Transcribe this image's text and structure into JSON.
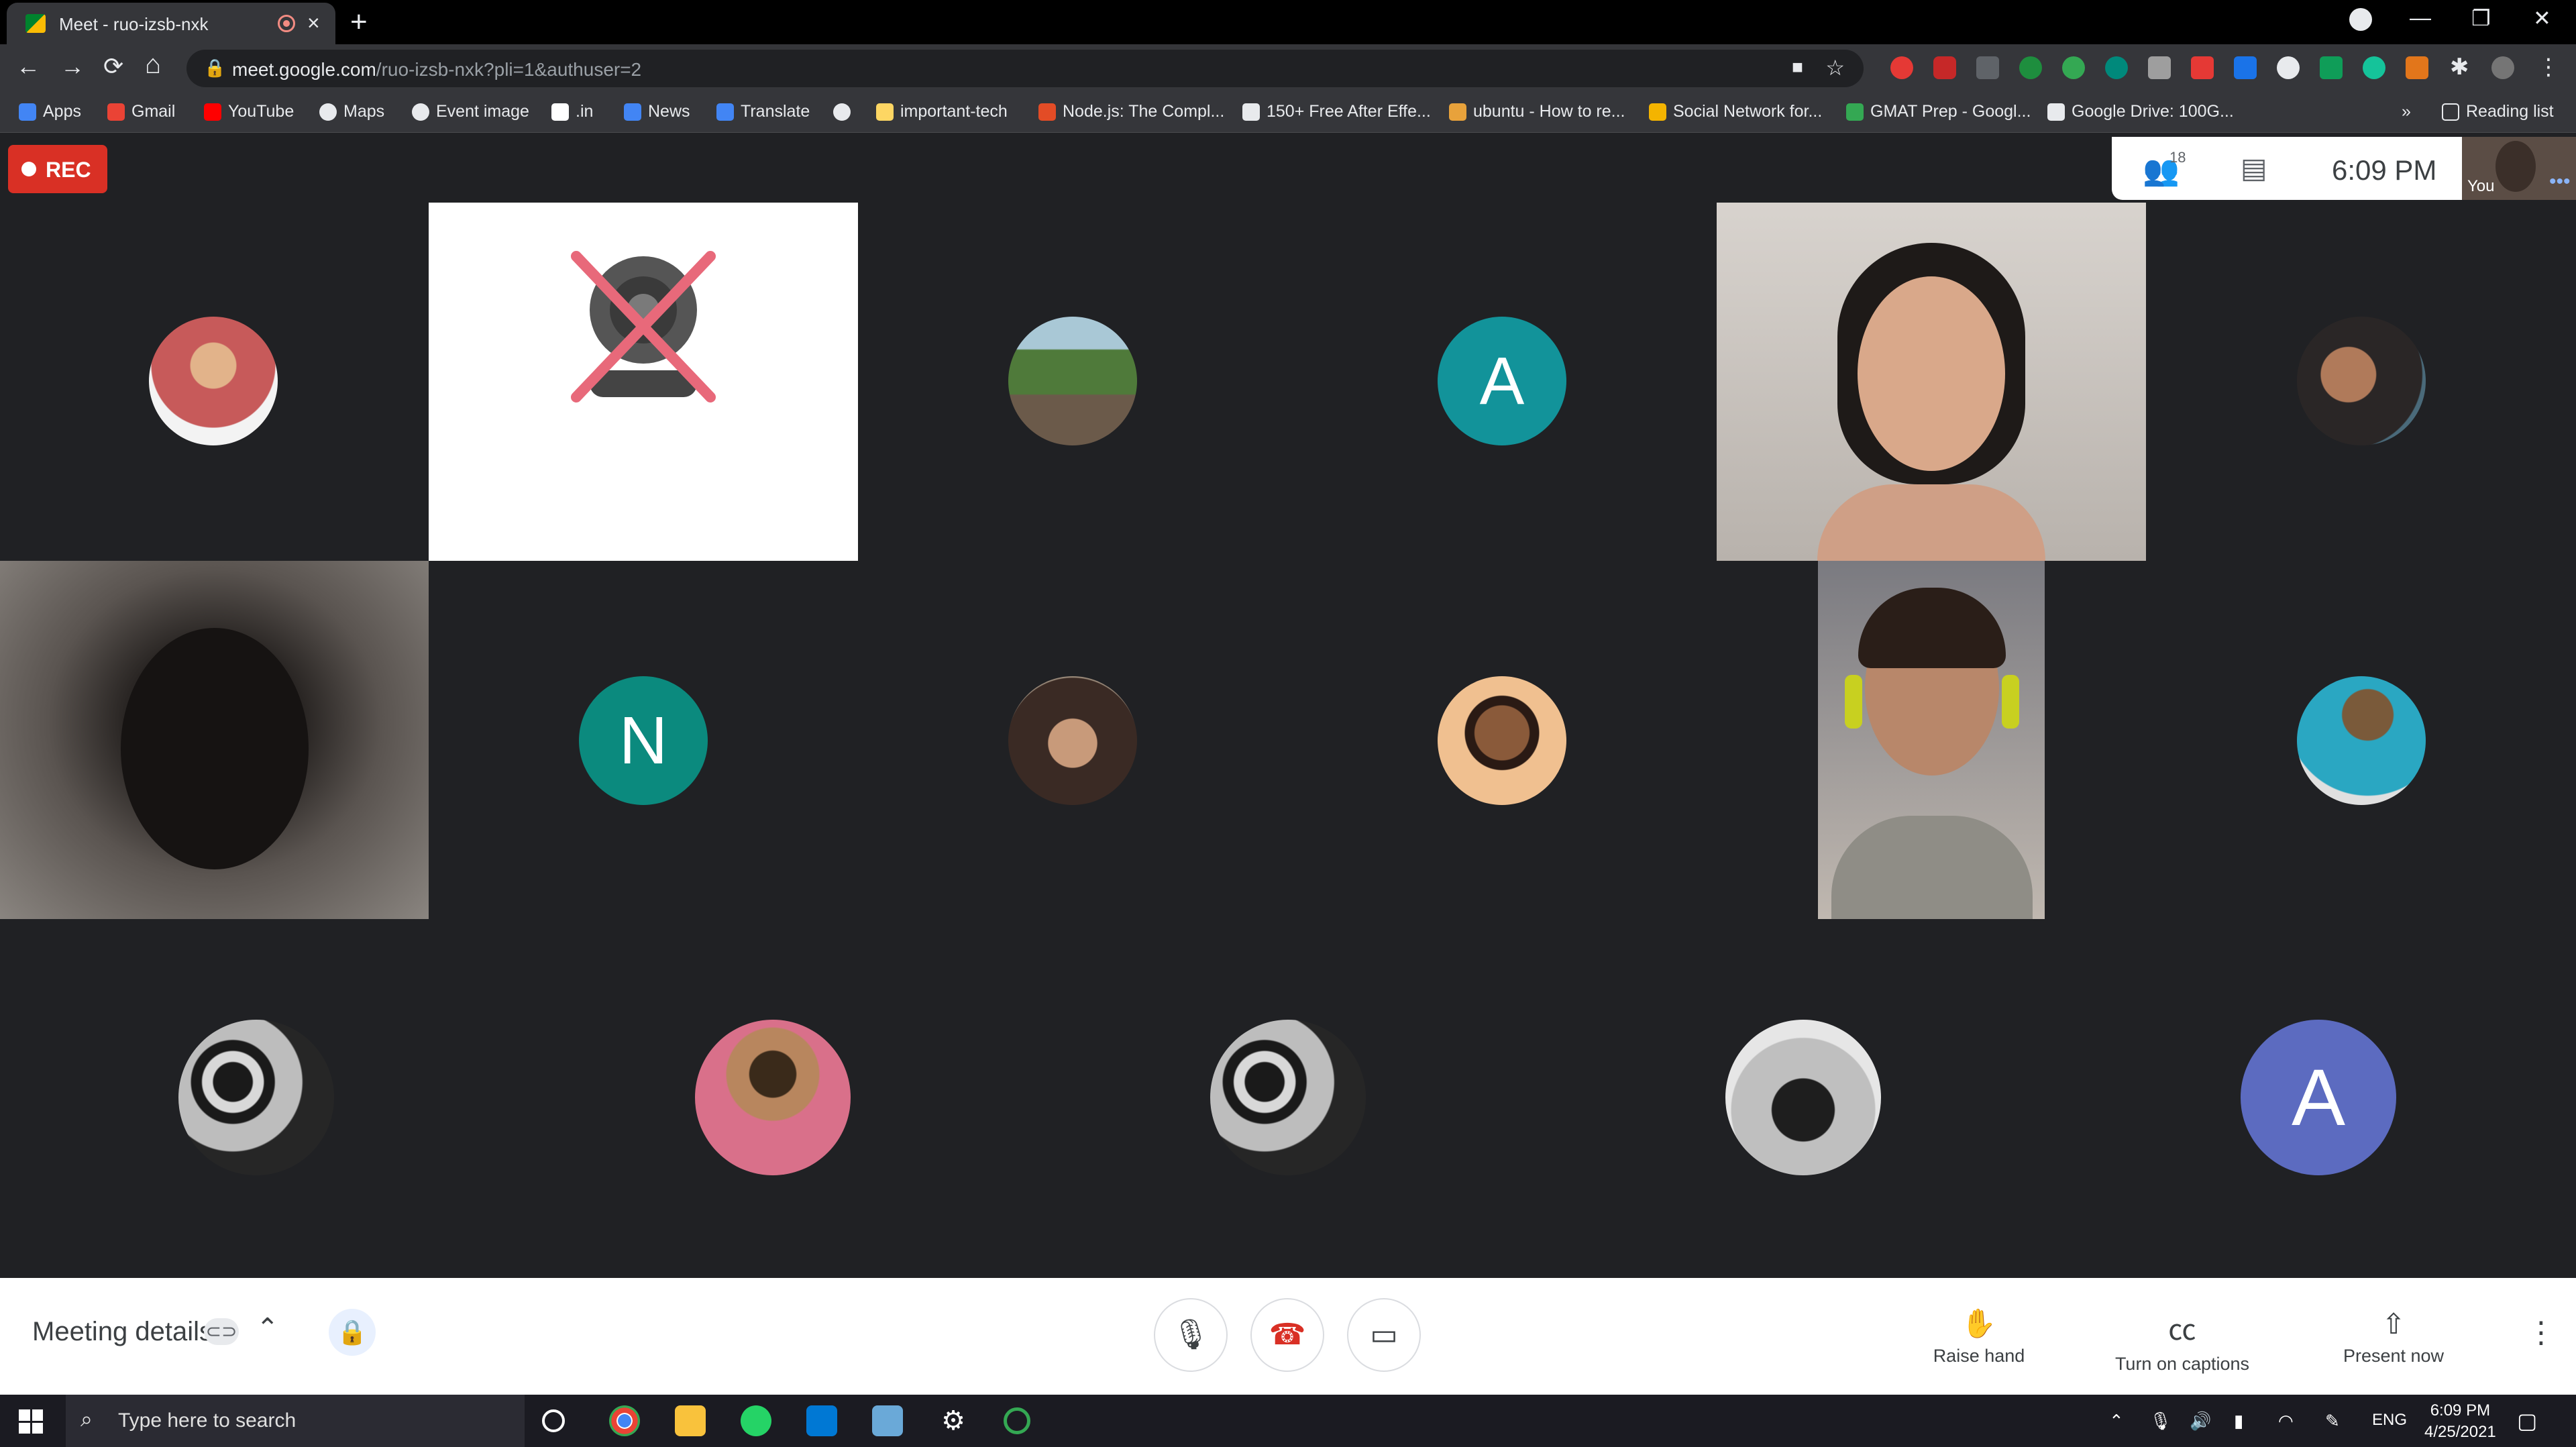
{
  "browser": {
    "tab_title": "Meet - ruo-izsb-nxk",
    "tab_close": "×",
    "new_tab": "+",
    "url_host": "meet.google.com",
    "url_path": "/ruo-izsb-nxk?pli=1&authuser=2",
    "nav": {
      "back": "←",
      "forward": "→",
      "reload": "⟳",
      "home": "⌂"
    },
    "window_controls": {
      "minimize": "—",
      "restore": "❐",
      "close": "✕"
    },
    "bookmarks": [
      {
        "label": "Apps",
        "color": "#4285f4"
      },
      {
        "label": "Gmail",
        "color": "#ea4335"
      },
      {
        "label": "YouTube",
        "color": "#ff0000"
      },
      {
        "label": "Maps",
        "color": "#e8eaed"
      },
      {
        "label": "Event image",
        "color": "#e8eaed"
      },
      {
        "label": ".in",
        "color": "#ffffff"
      },
      {
        "label": "News",
        "color": "#4285f4"
      },
      {
        "label": "Translate",
        "color": "#4285f4"
      },
      {
        "label": "",
        "color": "#e8eaed"
      },
      {
        "label": "important-tech",
        "color": "#fdd663"
      },
      {
        "label": "Node.js: The Compl...",
        "color": "#e34c26"
      },
      {
        "label": "150+ Free After Effe...",
        "color": "#e8eaed"
      },
      {
        "label": "ubuntu - How to re...",
        "color": "#e8a23b"
      },
      {
        "label": "Social Network for...",
        "color": "#f4b400"
      },
      {
        "label": "GMAT Prep - Googl...",
        "color": "#34a853"
      },
      {
        "label": "Google Drive: 100G...",
        "color": "#e8eaed"
      }
    ],
    "bookmarks_more": "»",
    "reading_list": "Reading list"
  },
  "meet": {
    "rec_label": "REC",
    "participant_count": "18",
    "time": "6:09 PM",
    "self_label": "You",
    "meeting_details": "Meeting details",
    "controls": {
      "raise_hand": "Raise hand",
      "captions": "Turn on captions",
      "present": "Present now"
    },
    "tiles": [
      {
        "type": "photo",
        "color": "#c75a5a"
      },
      {
        "type": "camera-off",
        "color": "#ffffff"
      },
      {
        "type": "photo",
        "color": "#5f7e4a"
      },
      {
        "type": "letter",
        "letter": "A",
        "color": "#12939a"
      },
      {
        "type": "video",
        "color": "#c9c3bd"
      },
      {
        "type": "photo",
        "color": "#3e3a3a"
      },
      {
        "type": "video",
        "color": "#3a3735"
      },
      {
        "type": "letter",
        "letter": "N",
        "color": "#0b8a7e"
      },
      {
        "type": "photo",
        "color": "#8a6a5a"
      },
      {
        "type": "photo",
        "color": "#b88a5a"
      },
      {
        "type": "video",
        "color": "#a6a09a"
      },
      {
        "type": "photo",
        "color": "#2aa7c2"
      },
      {
        "type": "photo",
        "color": "#7a7a7a"
      },
      {
        "type": "photo",
        "color": "#d9708a"
      },
      {
        "type": "photo",
        "color": "#7a7a7a"
      },
      {
        "type": "photo",
        "color": "#9a9a9a"
      },
      {
        "type": "letter",
        "letter": "A",
        "color": "#5c6bc0"
      }
    ]
  },
  "taskbar": {
    "search_placeholder": "Type here to search",
    "lang": "ENG",
    "clock_time": "6:09 PM",
    "clock_date": "4/25/2021"
  }
}
